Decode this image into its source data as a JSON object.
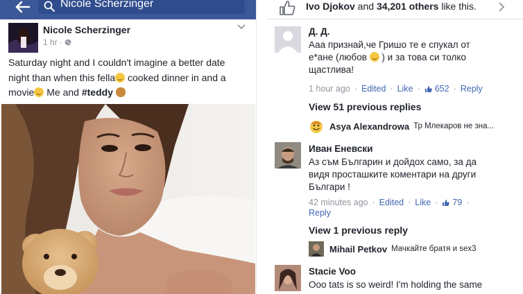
{
  "search": {
    "query": "Nicole Scherzinger"
  },
  "post": {
    "author": "Nicole Scherzinger",
    "time": "1 hr ·",
    "text_line1": "Saturday night and I couldn't imagine a better date",
    "text_line2a": "night than when this fella",
    "text_line2b": " cooked dinner in and a",
    "text_line3a": "movie",
    "text_line3b": " Me and ",
    "hashtag": "#teddy"
  },
  "likes": {
    "name": "Ivo Djokov",
    "conj": " and ",
    "count": "34,201 others",
    "suffix": " like this."
  },
  "comments": [
    {
      "name": "Д. Д.",
      "line1": "Ааа признай,че Гришо те е спукал от",
      "line2a": "е*ане (любов ",
      "line2b": " ) и за това си толко",
      "line3": "щастлива!",
      "time": "1 hour ago",
      "edited": "Edited",
      "like": "Like",
      "likes": "652",
      "reply": "Reply"
    },
    {
      "name": "Иван Еневски",
      "line1": "Аз съм Българин и дойдох само, за да",
      "line2": "видя просташките коментари на други",
      "line3": "Българи !",
      "time": "42 minutes ago",
      "edited": "Edited",
      "like": "Like",
      "likes": "79",
      "reply": "Reply"
    },
    {
      "name": "Stacie Voo",
      "line1": "Ooo tats is so weird! I'm holding the same"
    }
  ],
  "replies": [
    {
      "view_label": "View 51 previous replies",
      "name": "Asya Alexandrowa",
      "text": "Тр Млекаров не зна..."
    },
    {
      "view_label": "View 1 previous reply",
      "name": "Mihail Petkov",
      "text": "Мачкайте братя и sex3"
    }
  ],
  "colors": {
    "facebook_blue": "#3b5998",
    "link_blue": "#4267b2",
    "meta_gray": "#90949c"
  },
  "icons": {
    "back": "back-arrow-icon",
    "search": "search-icon",
    "thumb": "like-thumb-icon",
    "chevron_right": "chevron-right-icon",
    "chevron_down": "chevron-down-icon",
    "globe": "globe-icon"
  }
}
